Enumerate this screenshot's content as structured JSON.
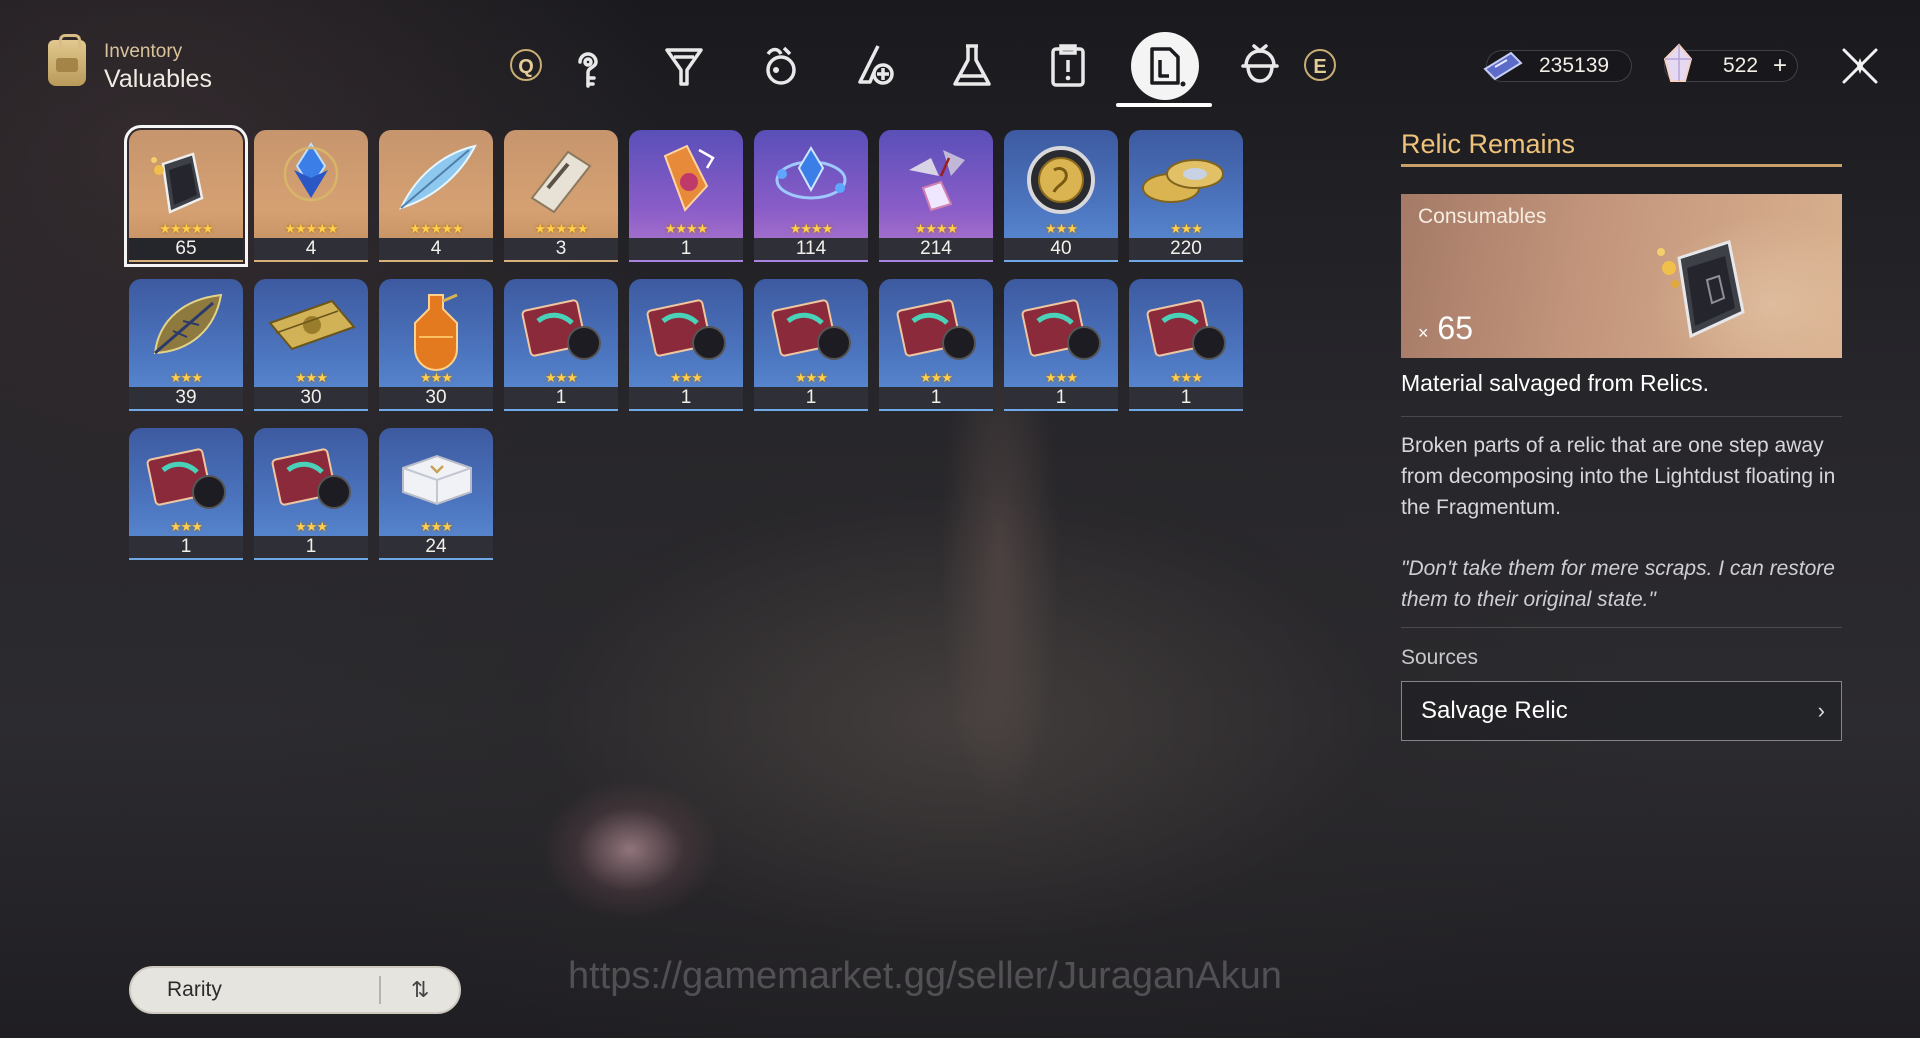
{
  "header": {
    "category_label": "Inventory",
    "title": "Valuables",
    "tab_prev_key": "Q",
    "tab_next_key": "E",
    "tabs": [
      "upgrade-materials-icon",
      "light-cone-exp-icon",
      "consumables-icon",
      "ascension-materials-icon",
      "synthesis-icon",
      "missions-icon",
      "valuables-icon",
      "other-materials-icon"
    ],
    "active_tab": 6
  },
  "currencies": [
    {
      "name": "star-rail-pass-icon",
      "value": "235139"
    },
    {
      "name": "stellar-jade-icon",
      "value": "522",
      "add_label": "+"
    }
  ],
  "close_label": "✕",
  "items": [
    {
      "icon": "relic-remains-icon",
      "stars": "★★★★★",
      "count": "65",
      "rarity": 5,
      "selected": true
    },
    {
      "icon": "blue-crystal-item-icon",
      "stars": "★★★★★",
      "count": "4",
      "rarity": 5
    },
    {
      "icon": "feather-item-icon",
      "stars": "★★★★★",
      "count": "4",
      "rarity": 5
    },
    {
      "icon": "pass-ticket-icon",
      "stars": "★★★★★",
      "count": "3",
      "rarity": 5
    },
    {
      "icon": "orange-device-icon",
      "stars": "★★★★",
      "count": "1",
      "rarity": 4
    },
    {
      "icon": "crystal-ring-icon",
      "stars": "★★★★",
      "count": "114",
      "rarity": 4
    },
    {
      "icon": "shard-fragments-icon",
      "stars": "★★★★",
      "count": "214",
      "rarity": 4
    },
    {
      "icon": "medal-coin-icon",
      "stars": "★★★",
      "count": "40",
      "rarity": 3
    },
    {
      "icon": "coins-stack-icon",
      "stars": "★★★",
      "count": "220",
      "rarity": 3
    },
    {
      "icon": "leaf-emblem-icon",
      "stars": "★★★",
      "count": "39",
      "rarity": 3
    },
    {
      "icon": "banknote-icon",
      "stars": "★★★",
      "count": "30",
      "rarity": 3
    },
    {
      "icon": "potion-bottle-icon",
      "stars": "★★★",
      "count": "30",
      "rarity": 3
    },
    {
      "icon": "record-disc-icon",
      "stars": "★★★",
      "count": "1",
      "rarity": 3
    },
    {
      "icon": "record-disc-icon",
      "stars": "★★★",
      "count": "1",
      "rarity": 3
    },
    {
      "icon": "record-disc-icon",
      "stars": "★★★",
      "count": "1",
      "rarity": 3
    },
    {
      "icon": "record-disc-icon",
      "stars": "★★★",
      "count": "1",
      "rarity": 3
    },
    {
      "icon": "record-disc-icon",
      "stars": "★★★",
      "count": "1",
      "rarity": 3
    },
    {
      "icon": "record-disc-icon",
      "stars": "★★★",
      "count": "1",
      "rarity": 3
    },
    {
      "icon": "record-disc-icon",
      "stars": "★★★",
      "count": "1",
      "rarity": 3
    },
    {
      "icon": "record-disc-icon",
      "stars": "★★★",
      "count": "1",
      "rarity": 3
    },
    {
      "icon": "white-box-icon",
      "stars": "★★★",
      "count": "24",
      "rarity": 3
    }
  ],
  "detail": {
    "title": "Relic Remains",
    "category": "Consumables",
    "qty_prefix": "×",
    "qty": "65",
    "summary": "Material salvaged from Relics.",
    "body": "Broken parts of a relic that are one step away from decomposing into the Lightdust floating in the Fragmentum.",
    "quote": "\"Don't take them for mere scraps. I can restore them to their original state.\"",
    "sources_label": "Sources",
    "source": "Salvage Relic",
    "source_chevron": "›"
  },
  "sort": {
    "label": "Rarity",
    "icon": "⇅"
  },
  "watermark": "https://gamemarket.gg/seller/JuraganAkun",
  "colors": {
    "accent": "#efc27a",
    "rarity5": "#d8b07b",
    "rarity4": "#a983e0",
    "rarity3": "#6fa9e8"
  }
}
